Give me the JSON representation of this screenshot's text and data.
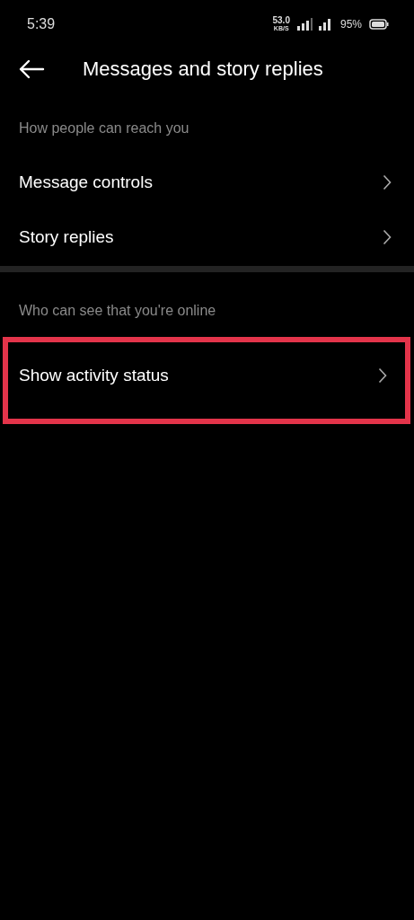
{
  "status_bar": {
    "time": "5:39",
    "net_speed": "53.0",
    "net_unit": "KB/S",
    "battery": "95%"
  },
  "header": {
    "title": "Messages and story replies"
  },
  "sections": [
    {
      "heading": "How people can reach you",
      "items": [
        {
          "label": "Message controls",
          "highlighted": false
        },
        {
          "label": "Story replies",
          "highlighted": false
        }
      ]
    },
    {
      "heading": "Who can see that you're online",
      "items": [
        {
          "label": "Show activity status",
          "highlighted": true
        }
      ]
    }
  ]
}
